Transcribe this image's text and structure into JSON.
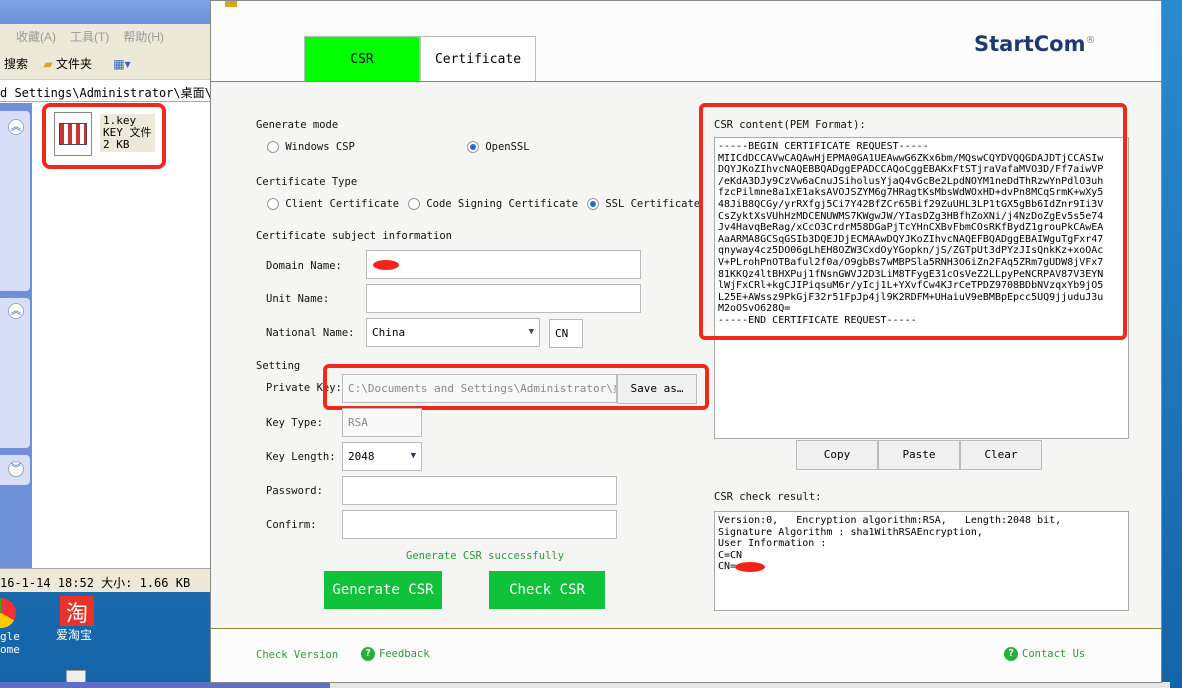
{
  "explorer": {
    "menu": [
      "收藏(A)",
      "工具(T)",
      "帮助(H)"
    ],
    "toolbar": {
      "search": "搜索",
      "folders": "文件夹"
    },
    "address": "d Settings\\Administrator\\桌面\\新建文",
    "file": {
      "name": "1.key",
      "type": "KEY 文件",
      "size": "2 KB"
    },
    "status": "16-1-14 18:52 大小: 1.66 KB"
  },
  "desktop": {
    "icons": [
      "gle\nome",
      "爱淘宝"
    ]
  },
  "dialog": {
    "tabs": [
      {
        "label": "CSR",
        "active": true
      },
      {
        "label": "Certificate",
        "active": false
      }
    ],
    "brand": "StartCom",
    "brand_mark": "®",
    "generate_mode": {
      "label": "Generate mode",
      "options": [
        {
          "label": "Windows CSP",
          "selected": false
        },
        {
          "label": "OpenSSL",
          "selected": true
        }
      ]
    },
    "cert_type": {
      "label": "Certificate Type",
      "options": [
        {
          "label": "Client Certificate",
          "selected": false
        },
        {
          "label": "Code Signing Certificate",
          "selected": false
        },
        {
          "label": "SSL Certificate",
          "selected": true
        }
      ]
    },
    "subject": {
      "label": "Certificate subject information",
      "domain_label": "Domain Name:",
      "unit_label": "Unit Name:",
      "unit_value": "",
      "national_label": "National Name:",
      "national_value": "China",
      "country_code": "CN"
    },
    "setting": {
      "label": "Setting",
      "private_key_label": "Private Key:",
      "private_key_value": "C:\\Documents and Settings\\Administrator\\桌面\\",
      "save_as": "Save as…",
      "key_type_label": "Key Type:",
      "key_type_value": "RSA",
      "key_length_label": "Key Length:",
      "key_length_value": "2048",
      "password_label": "Password:",
      "confirm_label": "Confirm:"
    },
    "status_message": "Generate CSR successfully",
    "generate_button": "Generate CSR",
    "check_button": "Check CSR",
    "csr_label": "CSR content(PEM Format):",
    "csr_content": "-----BEGIN CERTIFICATE REQUEST-----\nMIICdDCCAVwCAQAwHjEPMA0GA1UEAwwG6ZKx6bm/MQswCQYDVQQGDAJDTjCCASIw\nDQYJKoZIhvcNAQEBBQADggEPADCCAQoCggEBAKxFtSTjraVafaMVO3D/Ff7aiwVP\n/eKdA3DJy9CzVw6aCnuJSiholusYjaQ4vGcBe2LpdNOYM1neDdThRzwYnPdlO3uh\nfzcPilmne8a1xE1aksAVOJSZYM6g7HRagtKsMbsWdWOxHD+dvPn8MCqSrmK+wXy5\n48JiB8QCGy/yrRXfgj5Ci7Y42BfZCr65Bif29ZuUHL3LP1tGX5gBb6IdZnr9Ii3V\nCsZyktXsVUhHzMDCENUWMS7KWgwJW/YIasDZg3HBfhZoXNi/j4NzDoZgEv5s5e74\nJv4HavqBeRag/xCcO3CrdrM58DGaPjTcYHnCXBvFbmCOsRKfBydZ1grouPkCAwEA\nAaARMA8GCSqGSIb3DQEJDjECMAAwDQYJKoZIhvcNAQEFBQADggEBAIWguTgFxr47\nqnyway4cz5DO06gLhEH8OZW3CxdOyYGopkn/jS/ZGTpUt3dPYzJIsQnkKz+xoOAc\nV+PLrohPnOTBaful2f0a/O9gbBs7wMBPSla5RNH3O6iZn2FAq5ZRm7gUDW8jVFx7\n81KKQz4ltBHXPuj1fNsnGWVJ2D3LiM8TFygE31cOsVeZ2LLpyPeNCRPAV87V3EYN\nlWjFxCRl+kgCJIPiqsuM6r/yIcj1L+YXvfCw4KJrCeTPDZ9708BDbNVzqxYb9jO5\nL25E+AWssz9PkGjF32r51FpJp4jl9K2RDFM+UHaiuV9eBMBpEpcc5UQ9jjuduJ3u\nM2oOSvO628Q=\n-----END CERTIFICATE REQUEST-----",
    "copy": "Copy",
    "paste": "Paste",
    "clear": "Clear",
    "check_label": "CSR check result:",
    "check_result": "Version:0,   Encryption algorithm:RSA,   Length:2048 bit,\nSignature Algorithm : sha1WithRSAEncryption,\nUser Information :\nC=CN\nCN=",
    "footer": {
      "check_version": "Check Version",
      "feedback": "Feedback",
      "contact": "Contact Us"
    },
    "colors": {
      "active_tab": "#00ff00",
      "button": "#10c23a",
      "highlight": "#f02a1a",
      "link": "#2a9a3a"
    }
  }
}
